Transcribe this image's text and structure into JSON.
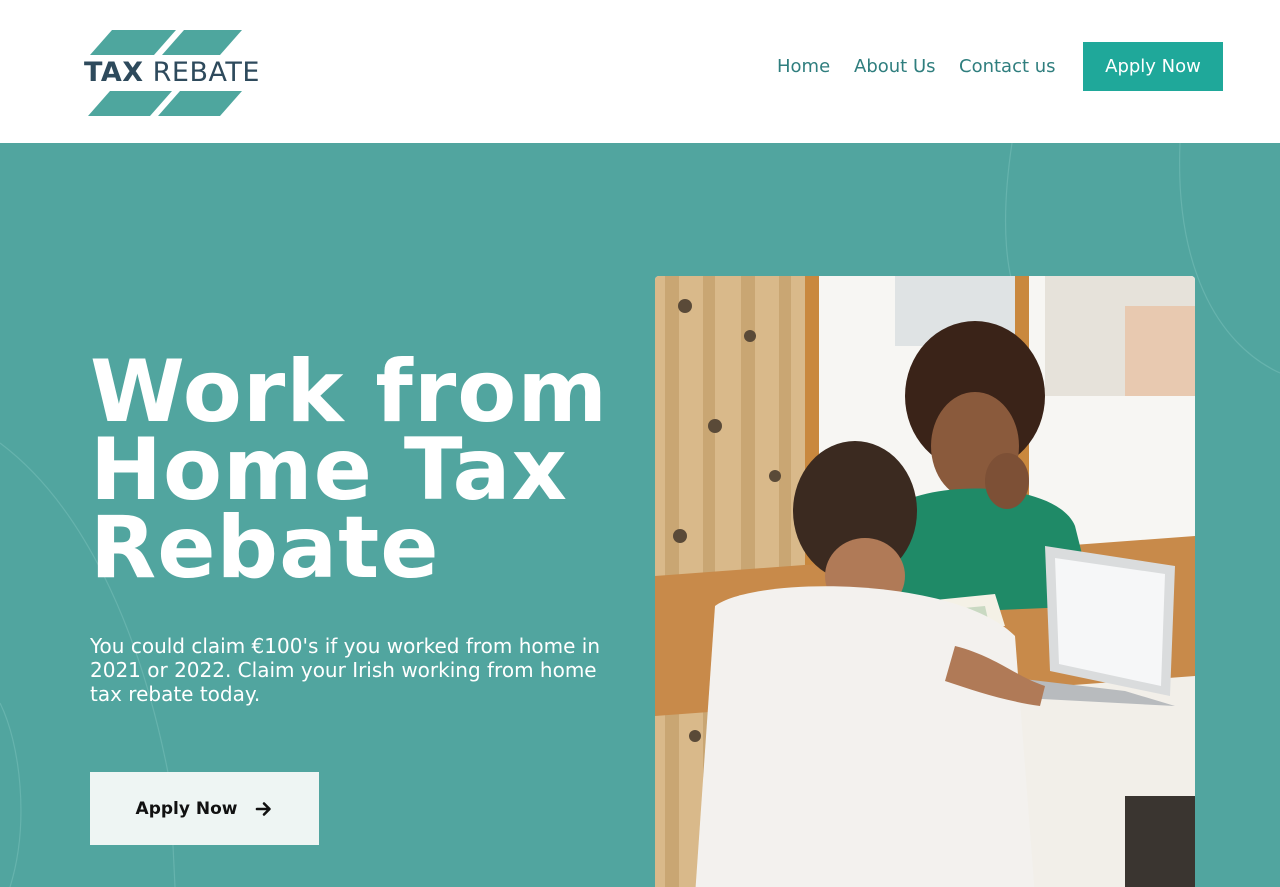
{
  "brand": {
    "logo_text_bold": "TAX",
    "logo_text_light": "REBATE",
    "primary_color": "#1fa89a",
    "hero_bg_color": "#51a59f",
    "logo_color": "#2e4a5c"
  },
  "nav": {
    "items": [
      {
        "label": "Home"
      },
      {
        "label": "About Us"
      },
      {
        "label": "Contact us"
      }
    ],
    "cta_label": "Apply Now"
  },
  "hero": {
    "title": "Work from Home Tax Rebate",
    "subtitle": "You could claim €100's if you worked from home in 2021 or 2022. Claim your Irish working from home tax rebate today.",
    "cta_label": "Apply Now",
    "cta_icon": "arrow-right-icon",
    "photo_alt": "Two people talking at a table with a laptop"
  }
}
